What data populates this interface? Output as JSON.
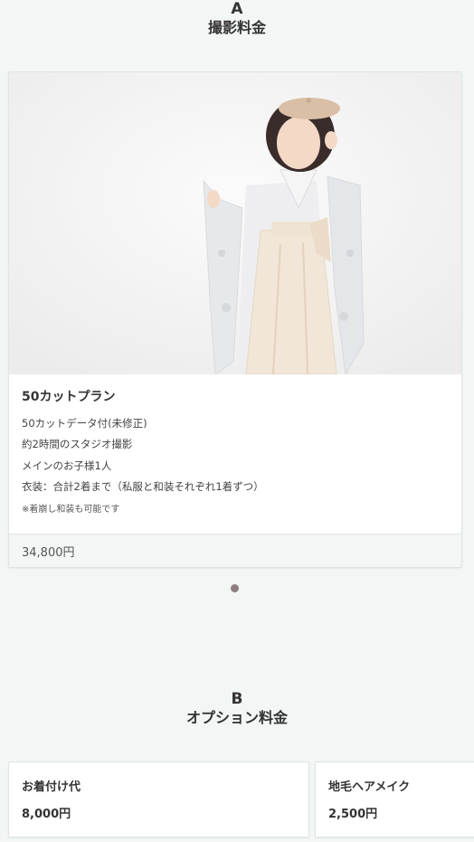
{
  "section_a": {
    "letter": "A",
    "title": "撮影料金"
  },
  "plan": {
    "name": "50カットプラン",
    "lines": [
      "50カットデータ付(未修正)",
      "約2時間のスタジオ撮影",
      "メインのお子様1人",
      "衣装：合計2着まで（私服と和装それぞれ1着ずつ）"
    ],
    "note": "※着崩し和装も可能です",
    "price": "34,800円",
    "photo_alt": "girl in kimono and hakama wearing beret"
  },
  "carousel": {
    "active_index": 0,
    "count": 1,
    "dot_color": "#8c7e7e"
  },
  "section_b": {
    "letter": "B",
    "title": "オプション料金"
  },
  "options": [
    {
      "name": "お着付け代",
      "price": "8,000円"
    },
    {
      "name": "地毛ヘアメイク",
      "price": "2,500円"
    }
  ],
  "colors": {
    "background": "#f2f6f4",
    "card": "#ffffff",
    "price_bar": "#f4f6f5"
  }
}
